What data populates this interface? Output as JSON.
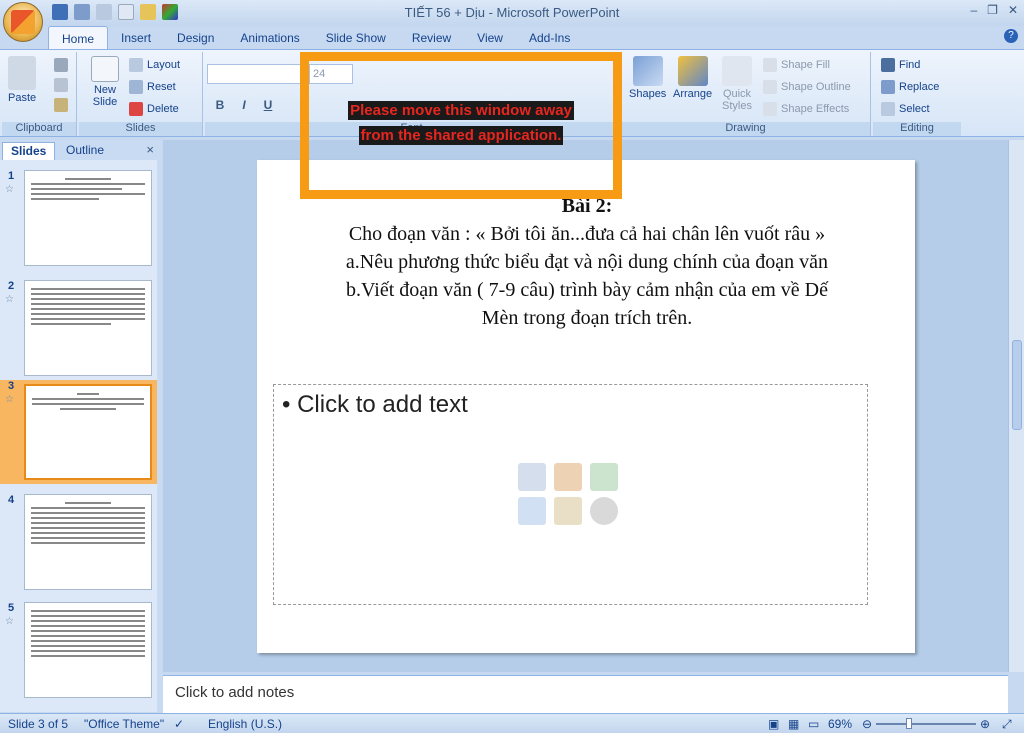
{
  "window": {
    "title": "TIẾT 56 + Dịu - Microsoft PowerPoint"
  },
  "tabs": [
    "Home",
    "Insert",
    "Design",
    "Animations",
    "Slide Show",
    "Review",
    "View",
    "Add-Ins"
  ],
  "ribbon": {
    "clipboard": {
      "label": "Clipboard",
      "paste": "Paste"
    },
    "slides": {
      "label": "Slides",
      "new_slide": "New Slide",
      "layout": "Layout",
      "reset": "Reset",
      "delete": "Delete"
    },
    "font": {
      "label": "Font",
      "size": "24"
    },
    "drawing": {
      "label": "Drawing",
      "shapes": "Shapes",
      "arrange": "Arrange",
      "quick_styles": "Quick Styles",
      "shape_fill": "Shape Fill",
      "shape_outline": "Shape Outline",
      "shape_effects": "Shape Effects"
    },
    "editing": {
      "label": "Editing",
      "find": "Find",
      "replace": "Replace",
      "select": "Select"
    }
  },
  "overlay": {
    "line1": "Please move this window away",
    "line2": "from the shared application."
  },
  "panel": {
    "tab_slides": "Slides",
    "tab_outline": "Outline",
    "close": "×"
  },
  "thumbnails": [
    "1",
    "2",
    "3",
    "4",
    "5"
  ],
  "slide": {
    "heading": "Bài 2:",
    "line1": "Cho đoạn văn : «  Bởi tôi ăn...đưa cả hai chân lên vuốt râu »",
    "line2": "a.Nêu phương thức biểu đạt và nội dung chính của đoạn văn",
    "line3": "b.Viết đoạn văn ( 7-9 câu) trình bày cảm nhận của em về Dế",
    "line4": "Mèn trong đoạn trích trên.",
    "placeholder": "• Click to add text"
  },
  "notes": {
    "placeholder": "Click to add notes"
  },
  "status": {
    "slide": "Slide 3 of 5",
    "theme": "\"Office Theme\"",
    "language": "English (U.S.)",
    "zoom": "69%"
  }
}
